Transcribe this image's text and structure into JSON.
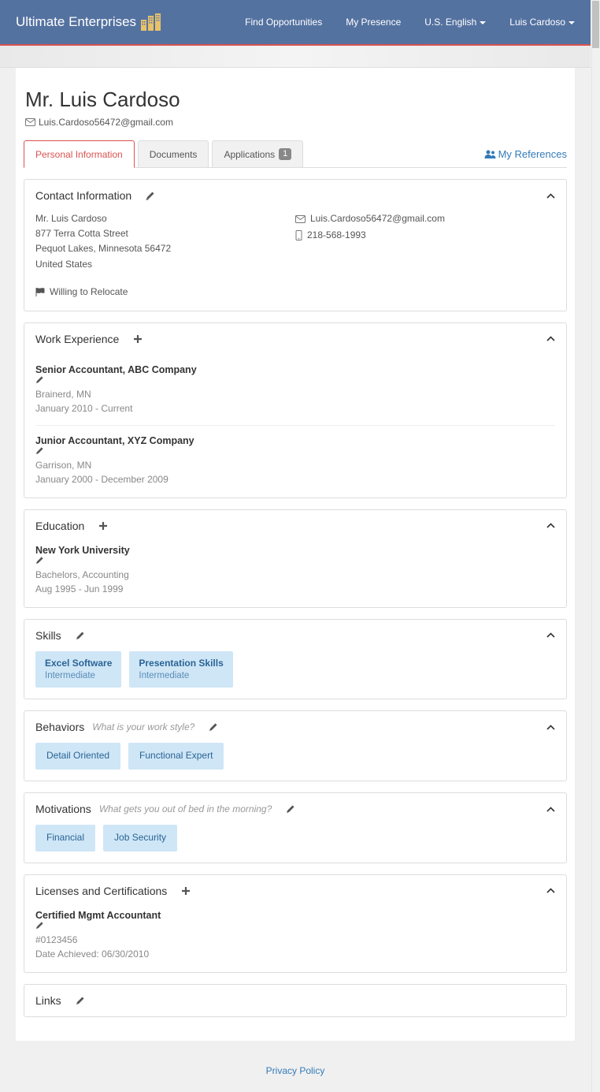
{
  "brand": "Ultimate Enterprises",
  "nav": {
    "find": "Find Opportunities",
    "presence": "My Presence",
    "locale": "U.S. English",
    "user": "Luis Cardoso"
  },
  "page": {
    "title": "Mr. Luis Cardoso",
    "email": "Luis.Cardoso56472@gmail.com"
  },
  "tabs": {
    "t0": "Personal Information",
    "t1": "Documents",
    "t2": "Applications",
    "t2badge": "1"
  },
  "references_link": "My References",
  "sections": {
    "contact": {
      "title": "Contact Information",
      "name": "Mr. Luis Cardoso",
      "street": "877 Terra Cotta Street",
      "citystate": "Pequot Lakes, Minnesota 56472",
      "country": "United States",
      "email": "Luis.Cardoso56472@gmail.com",
      "phone": "218-568-1993",
      "relocate": "Willing to Relocate"
    },
    "work": {
      "title": "Work Experience",
      "e0": {
        "title": "Senior Accountant, ABC Company",
        "loc": "Brainerd, MN",
        "dates": "January 2010 - Current"
      },
      "e1": {
        "title": "Junior Accountant, XYZ Company",
        "loc": "Garrison, MN",
        "dates": "January 2000 - December 2009"
      }
    },
    "edu": {
      "title": "Education",
      "e0": {
        "title": "New York University",
        "degree": "Bachelors, Accounting",
        "dates": "Aug 1995 - Jun 1999"
      }
    },
    "skills": {
      "title": "Skills",
      "s0": {
        "name": "Excel Software",
        "lvl": "Intermediate"
      },
      "s1": {
        "name": "Presentation Skills",
        "lvl": "Intermediate"
      }
    },
    "behaviors": {
      "title": "Behaviors",
      "hint": "What is your work style?",
      "b0": "Detail Oriented",
      "b1": "Functional Expert"
    },
    "motivations": {
      "title": "Motivations",
      "hint": "What gets you out of bed in the morning?",
      "m0": "Financial",
      "m1": "Job Security"
    },
    "licenses": {
      "title": "Licenses and Certifications",
      "e0": {
        "title": "Certified Mgmt Accountant",
        "num": "#0123456",
        "date": "Date Achieved: 06/30/2010"
      }
    },
    "links": {
      "title": "Links"
    }
  },
  "footer": {
    "privacy": "Privacy Policy"
  }
}
